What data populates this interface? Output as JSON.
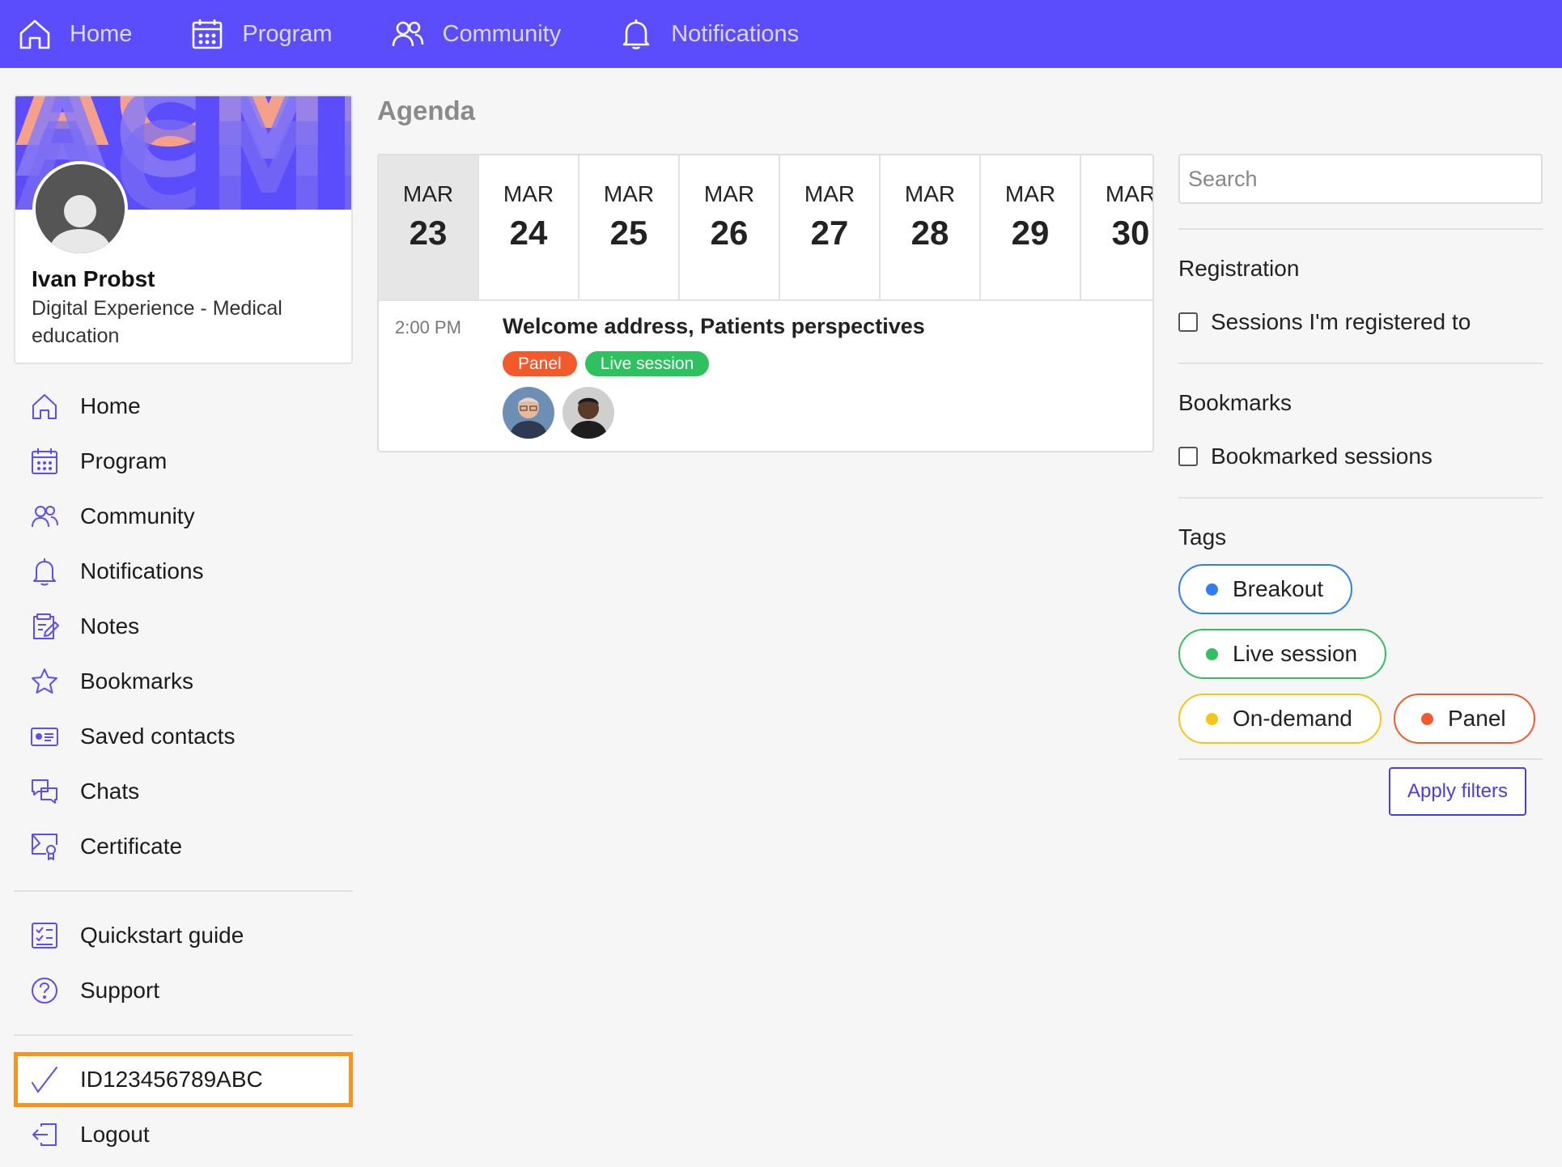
{
  "topnav": {
    "items": [
      {
        "label": "Home",
        "icon": "home-icon"
      },
      {
        "label": "Program",
        "icon": "calendar-icon"
      },
      {
        "label": "Community",
        "icon": "community-icon"
      },
      {
        "label": "Notifications",
        "icon": "bell-icon"
      }
    ]
  },
  "profile": {
    "banner_text": "ACME",
    "name": "Ivan Probst",
    "title": "Digital Experience - Medical education"
  },
  "sidebar": {
    "items": [
      {
        "label": "Home",
        "icon": "home-icon"
      },
      {
        "label": "Program",
        "icon": "calendar-icon"
      },
      {
        "label": "Community",
        "icon": "community-icon"
      },
      {
        "label": "Notifications",
        "icon": "bell-icon"
      },
      {
        "label": "Notes",
        "icon": "notes-icon"
      },
      {
        "label": "Bookmarks",
        "icon": "star-icon"
      },
      {
        "label": "Saved contacts",
        "icon": "contact-card-icon"
      },
      {
        "label": "Chats",
        "icon": "chat-icon"
      },
      {
        "label": "Certificate",
        "icon": "certificate-icon"
      }
    ],
    "secondary": [
      {
        "label": "Quickstart guide",
        "icon": "checklist-icon"
      },
      {
        "label": "Support",
        "icon": "help-icon"
      }
    ],
    "id_item": {
      "label": "ID123456789ABC",
      "icon": "checkmark-icon"
    },
    "logout": {
      "label": "Logout",
      "icon": "logout-icon"
    }
  },
  "main": {
    "title": "Agenda",
    "dates": [
      {
        "month": "MAR",
        "day": "23",
        "selected": true
      },
      {
        "month": "MAR",
        "day": "24"
      },
      {
        "month": "MAR",
        "day": "25"
      },
      {
        "month": "MAR",
        "day": "26"
      },
      {
        "month": "MAR",
        "day": "27"
      },
      {
        "month": "MAR",
        "day": "28"
      },
      {
        "month": "MAR",
        "day": "29"
      },
      {
        "month": "MAR",
        "day": "30"
      }
    ],
    "sessions": [
      {
        "time": "2:00 PM",
        "title": "Welcome address, Patients perspectives",
        "tags": [
          "Panel",
          "Live session"
        ]
      }
    ]
  },
  "filters": {
    "search_placeholder": "Search",
    "registration": {
      "heading": "Registration",
      "option": "Sessions I'm registered to"
    },
    "bookmarks": {
      "heading": "Bookmarks",
      "option": "Bookmarked sessions"
    },
    "tags": {
      "heading": "Tags",
      "items": [
        {
          "label": "Breakout",
          "color": "#2f7ef5"
        },
        {
          "label": "Live session",
          "color": "#2fc15f"
        },
        {
          "label": "On-demand",
          "color": "#f5c518"
        },
        {
          "label": "Panel",
          "color": "#f25a2b"
        }
      ]
    },
    "apply_label": "Apply filters"
  },
  "colors": {
    "brand": "#5b4cfc",
    "highlight": "#f7931e"
  }
}
